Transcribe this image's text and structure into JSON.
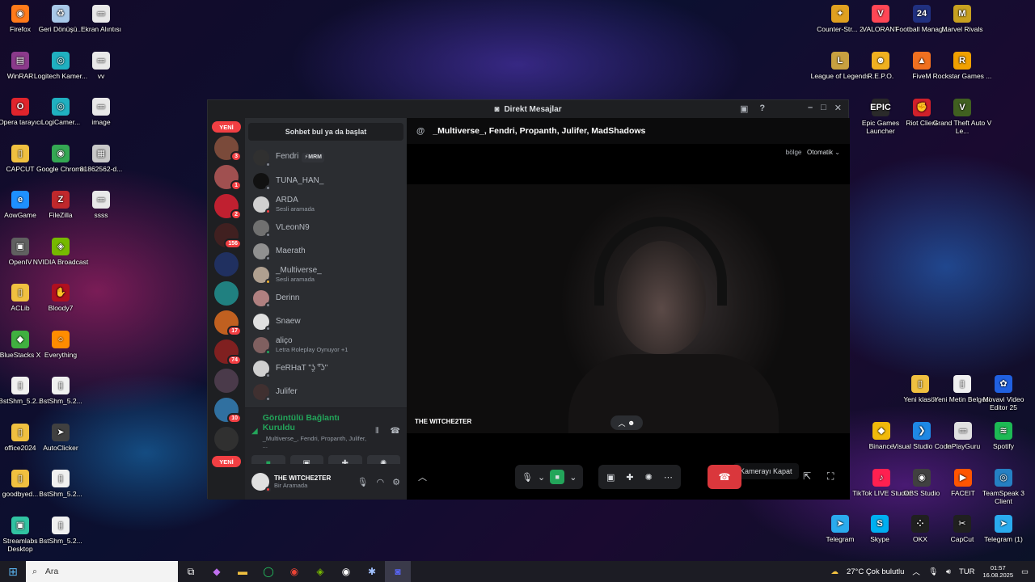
{
  "desktop": {
    "left_icons": [
      {
        "label": "Firefox",
        "color": "#ff7a1a",
        "glyph": "◉"
      },
      {
        "label": "Geri Dönüşü...",
        "color": "#a8c8e8",
        "glyph": "♻"
      },
      {
        "label": "Ekran Alıntısı",
        "color": "#e8e8e8",
        "glyph": "▭"
      },
      {
        "label": "WinRAR",
        "color": "#8b3a8b",
        "glyph": "▤"
      },
      {
        "label": "Logitech Kamer...",
        "color": "#20b0c0",
        "glyph": "◎"
      },
      {
        "label": "vv",
        "color": "#e8e8e8",
        "glyph": "▭"
      },
      {
        "label": "Opera tarayıcı",
        "color": "#e0242c",
        "glyph": "O"
      },
      {
        "label": "LogiCamer...",
        "color": "#20b0c0",
        "glyph": "◎"
      },
      {
        "label": "image",
        "color": "#e8e8e8",
        "glyph": "▭"
      },
      {
        "label": "CAPCUT",
        "color": "#f0c040",
        "glyph": "▯"
      },
      {
        "label": "Google Chrome",
        "color": "#34a853",
        "glyph": "◉"
      },
      {
        "label": "81862562-d...",
        "color": "#c8c8c8",
        "glyph": "▦"
      },
      {
        "label": "AowGame",
        "color": "#1e90ff",
        "glyph": "e"
      },
      {
        "label": "FileZilla",
        "color": "#c0282c",
        "glyph": "Z"
      },
      {
        "label": "ssss",
        "color": "#e8e8e8",
        "glyph": "▭"
      },
      {
        "label": "OpenIV",
        "color": "#606060",
        "glyph": "▣"
      },
      {
        "label": "NVIDIA Broadcast",
        "color": "#76b900",
        "glyph": "◈"
      },
      {
        "label": "ACLib",
        "color": "#f0c040",
        "glyph": "▯"
      },
      {
        "label": "Bloody7",
        "color": "#b01020",
        "glyph": "✋"
      },
      {
        "label": "BlueStacks X",
        "color": "#40b040",
        "glyph": "◆"
      },
      {
        "label": "Everything",
        "color": "#ff8c00",
        "glyph": "○"
      },
      {
        "label": "BstShm_5.2...",
        "color": "#f0f0f0",
        "glyph": "▯"
      },
      {
        "label": "BstShm_5.2...",
        "color": "#f0f0f0",
        "glyph": "▯"
      },
      {
        "label": "office2024",
        "color": "#f0c040",
        "glyph": "▯"
      },
      {
        "label": "AutoClicker",
        "color": "#404040",
        "glyph": "➤"
      },
      {
        "label": "goodbyed...",
        "color": "#f0c040",
        "glyph": "▯"
      },
      {
        "label": "BstShm_5.2...",
        "color": "#f0f0f0",
        "glyph": "▯"
      },
      {
        "label": "Streamlabs Desktop",
        "color": "#31c3a2",
        "glyph": "▣"
      },
      {
        "label": "BstShm_5.2...",
        "color": "#f0f0f0",
        "glyph": "▯"
      }
    ],
    "right_icons": [
      {
        "label": "Counter-Str... 2",
        "color": "#e0a020",
        "glyph": "✦"
      },
      {
        "label": "VALORANT",
        "color": "#ff4655",
        "glyph": "V"
      },
      {
        "label": "Football Manag...",
        "color": "#203080",
        "glyph": "24"
      },
      {
        "label": "Marvel Rivals",
        "color": "#c8a020",
        "glyph": "M"
      },
      {
        "label": "League of Legends",
        "color": "#c8a040",
        "glyph": "L"
      },
      {
        "label": "R.E.P.O.",
        "color": "#f0b020",
        "glyph": "☻"
      },
      {
        "label": "FiveM",
        "color": "#f07020",
        "glyph": "▲"
      },
      {
        "label": "Rockstar Games ...",
        "color": "#f0a000",
        "glyph": "R"
      },
      {
        "label": "Epic Games Launcher",
        "color": "#2a2a2a",
        "glyph": "EPIC"
      },
      {
        "label": "Riot Client",
        "color": "#d0202a",
        "glyph": "✊"
      },
      {
        "label": "Grand Theft Auto V Le...",
        "color": "#406020",
        "glyph": "V"
      },
      {
        "label": "Yeni klasör",
        "color": "#f0c040",
        "glyph": "▯"
      },
      {
        "label": "Yeni Metin Belgesi",
        "color": "#f0f0f0",
        "glyph": "▯"
      },
      {
        "label": "Movavi Video Editor 25",
        "color": "#2060e0",
        "glyph": "✿"
      },
      {
        "label": "Binance",
        "color": "#f0b90b",
        "glyph": "◆"
      },
      {
        "label": "Visual Studio Code",
        "color": "#1e88e5",
        "glyph": "❯"
      },
      {
        "label": "InPlayGuru",
        "color": "#e0e0e0",
        "glyph": "▭"
      },
      {
        "label": "Spotify",
        "color": "#1db954",
        "glyph": "≋"
      },
      {
        "label": "TikTok LIVE Studio",
        "color": "#ff2050",
        "glyph": "♪"
      },
      {
        "label": "OBS Studio",
        "color": "#404040",
        "glyph": "◉"
      },
      {
        "label": "FACEIT",
        "color": "#ff5500",
        "glyph": "▶"
      },
      {
        "label": "TeamSpeak 3 Client",
        "color": "#2580c3",
        "glyph": "◎"
      },
      {
        "label": "Telegram",
        "color": "#2aabee",
        "glyph": "➤"
      },
      {
        "label": "Skype",
        "color": "#00aff0",
        "glyph": "S"
      },
      {
        "label": "OKX",
        "color": "#202020",
        "glyph": "⁘"
      },
      {
        "label": "CapCut",
        "color": "#202020",
        "glyph": "✂"
      },
      {
        "label": "Telegram (1)",
        "color": "#2aabee",
        "glyph": "➤"
      }
    ]
  },
  "window": {
    "title": "Direkt Mesajlar",
    "title_icon": "discord-icon"
  },
  "guilds": {
    "new_top": "YENİ",
    "new_bottom": "YENİ",
    "items": [
      {
        "color": "#7a4a3a",
        "badge": "3"
      },
      {
        "color": "#a05050",
        "badge": "1"
      },
      {
        "color": "#c02030",
        "badge": "2"
      },
      {
        "color": "#402020",
        "badge": "156"
      },
      {
        "color": "#203060",
        "badge": ""
      },
      {
        "color": "#208080",
        "badge": ""
      },
      {
        "color": "#c06020",
        "badge": "17"
      },
      {
        "color": "#802020",
        "badge": "74"
      },
      {
        "color": "#4a3a4a",
        "badge": ""
      },
      {
        "color": "#3070a0",
        "badge": "10"
      },
      {
        "color": "#303030",
        "badge": ""
      }
    ]
  },
  "dm": {
    "search_label": "Sohbet bul ya da başlat",
    "items": [
      {
        "name": "Fendri",
        "sub": "",
        "tag": "⚡MRM",
        "color": "#303030",
        "status": "#80848e"
      },
      {
        "name": "TUNA_HAN_",
        "sub": "",
        "tag": "",
        "color": "#111",
        "status": "#80848e"
      },
      {
        "name": "ARDA",
        "sub": "Sesli aramada",
        "tag": "",
        "color": "#d0d0d0",
        "status": "#f23f43"
      },
      {
        "name": "VLeonN9",
        "sub": "",
        "tag": "",
        "color": "#707070",
        "status": "#80848e"
      },
      {
        "name": "Maerath",
        "sub": "",
        "tag": "",
        "color": "#909090",
        "status": "#80848e"
      },
      {
        "name": "_Multiverse_",
        "sub": "Sesli aramada",
        "tag": "",
        "color": "#b0a090",
        "status": "#f0b232"
      },
      {
        "name": "Derinn",
        "sub": "",
        "tag": "",
        "color": "#b08080",
        "status": "#80848e"
      },
      {
        "name": "Snaew",
        "sub": "",
        "tag": "",
        "color": "#e0e0e0",
        "status": "#80848e"
      },
      {
        "name": "aliço",
        "sub": "Letra Roleplay Oynuyor +1",
        "tag": "",
        "color": "#806060",
        "status": "#23a55a"
      },
      {
        "name": "FeRHaT \"ʖ̯ ͡°ʖ\"",
        "sub": "",
        "tag": "",
        "color": "#d0d0d0",
        "status": "#80848e"
      },
      {
        "name": "Julifer",
        "sub": "",
        "tag": "",
        "color": "#403030",
        "status": "#80848e"
      }
    ]
  },
  "voice_panel": {
    "status": "Görüntülü Bağlantı Kuruldu",
    "participants": "_Multiverse_, Fendri, Propanth, Julifer, ..."
  },
  "user": {
    "name": "THE WITCHE2TER",
    "status": "Bir Aramada"
  },
  "call": {
    "header": "_Multiverse_, Fendri, Propanth, Julifer, MadShadows",
    "region_label": "bölge",
    "region_value": "Otomatik",
    "video_label": "THE WITCHE2TER",
    "tooltip": "Kamerayı Kapat"
  },
  "taskbar": {
    "search_placeholder": "Ara",
    "weather": "27°C Çok bulutlu",
    "lang": "TUR",
    "time": "01:57",
    "date": "16.08.2025"
  }
}
